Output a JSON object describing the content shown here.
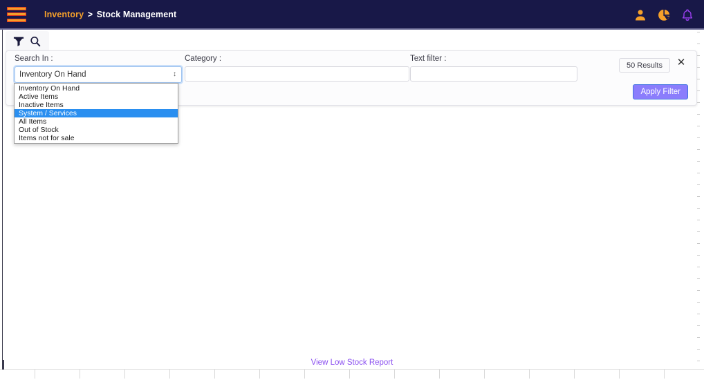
{
  "header": {
    "menu_icon": "hamburger-icon",
    "breadcrumb_root": "Inventory",
    "breadcrumb_separator": ">",
    "breadcrumb_current": "Stock Management",
    "icons": [
      {
        "name": "user-profile-icon",
        "color": "#f5a02a"
      },
      {
        "name": "pie-chart-icon",
        "color": "#f5a02a"
      },
      {
        "name": "notification-bell-icon",
        "color": "#9b3ff0"
      }
    ],
    "background_color": "#181848"
  },
  "tabs": [
    {
      "name": "filter-tab",
      "icon": "funnel-filter-icon"
    },
    {
      "name": "search-tab",
      "icon": "search-icon"
    }
  ],
  "filter_panel": {
    "search_in": {
      "label": "Search In :",
      "value": "Inventory On Hand",
      "arrow_glyph": "↕",
      "options": [
        "Inventory On Hand",
        "Active Items",
        "Inactive Items",
        "System / Services",
        "All Items",
        "Out of Stock",
        "Items not for sale"
      ],
      "selected_option": "System / Services",
      "selected_index": 3
    },
    "category": {
      "label": "Category :",
      "value": "",
      "placeholder": ""
    },
    "text_filter": {
      "label": "Text filter :",
      "value": "",
      "placeholder": ""
    },
    "results_badge": "50 Results",
    "close_glyph": "✕",
    "apply_button": "Apply Filter",
    "apply_button_color": "#8b7dfc"
  },
  "footer": {
    "low_stock_link": "View Low Stock Report",
    "link_color": "#8a4ef0"
  }
}
